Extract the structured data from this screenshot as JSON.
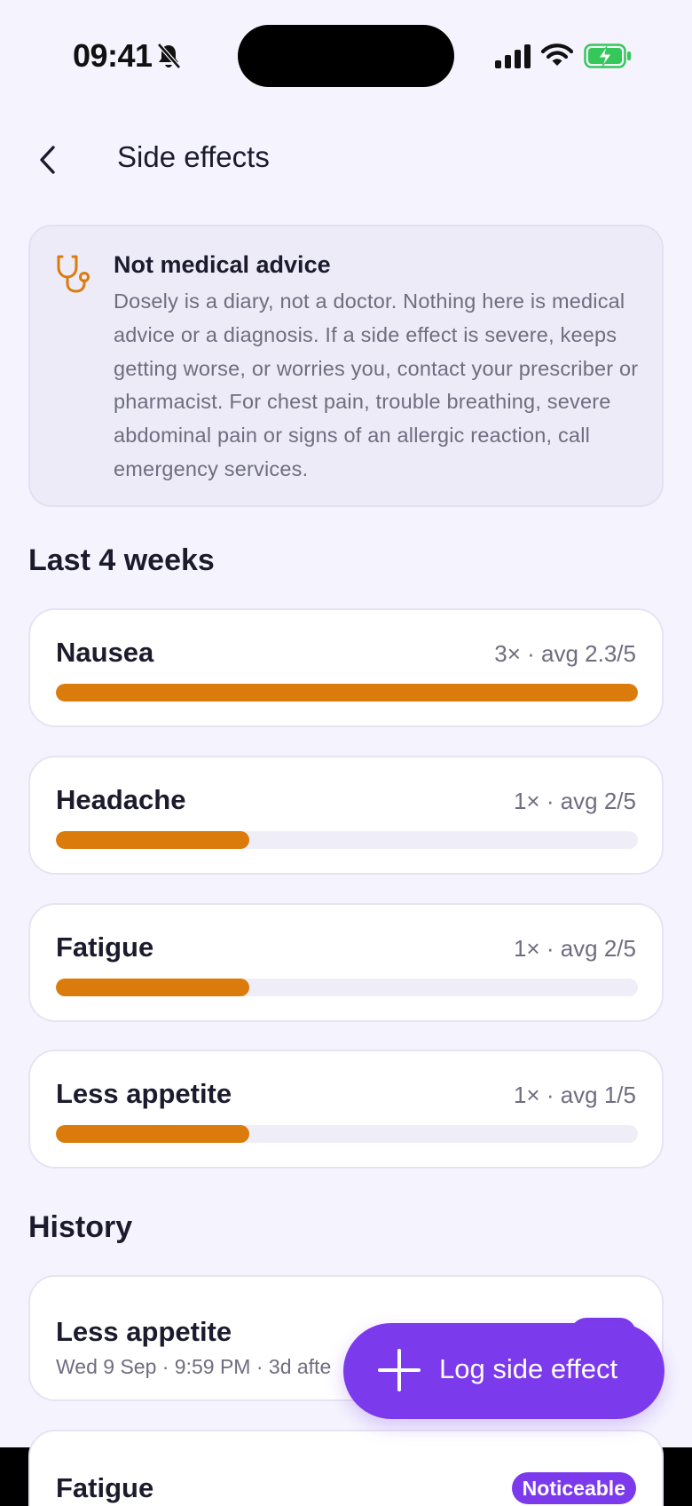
{
  "status_bar": {
    "time": "09:41"
  },
  "header": {
    "title": "Side effects"
  },
  "disclaimer": {
    "title": "Not medical advice",
    "body": "Dosely is a diary, not a doctor. Nothing here is medical advice or a diagnosis. If a side effect is severe, keeps getting worse, or worries you, contact your prescriber or pharmacist. For chest pain, trouble breathing, severe abdominal pain or signs of an allergic reaction, call emergency services."
  },
  "summary": {
    "title": "Last 4 weeks",
    "items": [
      {
        "name": "Nausea",
        "stat": "3× · avg 2.3/5",
        "level": 1.0
      },
      {
        "name": "Headache",
        "stat": "1× · avg 2/5",
        "level": 0.333
      },
      {
        "name": "Fatigue",
        "stat": "1× · avg 2/5",
        "level": 0.333
      },
      {
        "name": "Less appetite",
        "stat": "1× · avg 1/5",
        "level": 0.333
      }
    ]
  },
  "history": {
    "title": "History",
    "items": [
      {
        "name": "Less appetite",
        "meta": "Wed 9 Sep · 9:59 PM · 3d afte",
        "badge": ""
      },
      {
        "name": "Fatigue",
        "meta": "",
        "badge": "Noticeable"
      }
    ]
  },
  "fab": {
    "label": "Log side effect",
    "icon": "plus-icon"
  },
  "colors": {
    "accent": "#7c3aed",
    "bar": "#db7b0b",
    "background": "#f5f4fe"
  }
}
